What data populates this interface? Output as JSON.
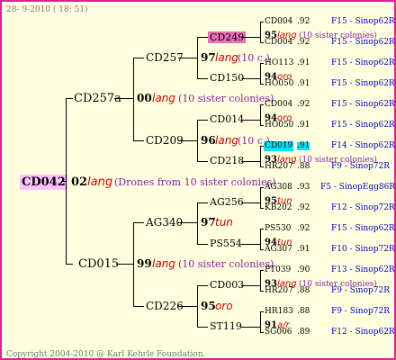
{
  "header": {
    "date": "28- 9-2010 ( 18: 51)"
  },
  "footer": {
    "copyright": "Copyright 2004-2010 @ Karl Kehrle Foundation."
  },
  "colors": {
    "border": "#e0209a",
    "background": "#ffffe0",
    "drone_red": "#d00000",
    "note_purple": "#8a1f9e",
    "source_blue": "#0000c8",
    "highlight_pink": "#ea6fb7",
    "highlight_cyan": "#00e5ff"
  },
  "root": {
    "name": "CD042",
    "year": "02",
    "breed": "lang",
    "note": "(Drones from 10 sister colonies)"
  },
  "gen1": [
    {
      "name": "CD257a",
      "year": "00",
      "breed": "lang",
      "note": "(10 sister colonies)"
    },
    {
      "name": "CD015",
      "year": "99",
      "breed": "lang",
      "note": "(10 sister colonies)"
    }
  ],
  "gen2": [
    {
      "name": "CD257",
      "year": "97",
      "breed": "lang",
      "note": "(10 c.)"
    },
    {
      "name": "CD209",
      "year": "96",
      "breed": "lang",
      "note": "(10 c.)"
    },
    {
      "name": "AG340",
      "year": "97",
      "breed": "tun",
      "note": ""
    },
    {
      "name": "CD226",
      "year": "95",
      "breed": "oro",
      "note": ""
    }
  ],
  "gen3": [
    {
      "name": "CD249",
      "year": "95",
      "breed": "lang",
      "note": "(10 sister colonies)"
    },
    {
      "name": "CD150",
      "year": "94",
      "breed": "oro",
      "note": ""
    },
    {
      "name": "CD014",
      "year": "94",
      "breed": "oro",
      "note": ""
    },
    {
      "name": "CD218",
      "year": "93",
      "breed": "lang",
      "note": "(10 sister colonies)"
    },
    {
      "name": "AG256",
      "year": "95",
      "breed": "tun",
      "note": ""
    },
    {
      "name": "PS554",
      "year": "94",
      "breed": "tun",
      "note": ""
    },
    {
      "name": "CD003",
      "year": "93",
      "breed": "lang",
      "note": "(10 sister colonies)"
    },
    {
      "name": "ST119",
      "year": "91",
      "breed": "a/r",
      "note": ""
    }
  ],
  "gen4": [
    {
      "name": "CD004",
      "year": ".92",
      "source": "F15 - Sinop62R"
    },
    {
      "name": "CD004",
      "year": ".92",
      "source": "F15 - Sinop62R"
    },
    {
      "name": "HO113",
      "year": ".91",
      "source": "F15 - Sinop62R"
    },
    {
      "name": "HO050",
      "year": ".91",
      "source": "F15 - Sinop62R"
    },
    {
      "name": "CD004",
      "year": ".92",
      "source": "F15 - Sinop62R"
    },
    {
      "name": "HO050",
      "year": ".91",
      "source": "F15 - Sinop62R"
    },
    {
      "name": "CD019",
      "year": ".91",
      "source": "F14 - Sinop62R"
    },
    {
      "name": "HR207",
      "year": ".88",
      "source": "F9 - Sinop72R"
    },
    {
      "name": "AG308",
      "year": ".93",
      "source": "F5 - SinopEgg86R"
    },
    {
      "name": "KB202",
      "year": ".92",
      "source": "F12 - Sinop72R"
    },
    {
      "name": "PS530",
      "year": ".92",
      "source": "F15 - Sinop62R"
    },
    {
      "name": "AG307",
      "year": ".91",
      "source": "F10 - Sinop72R"
    },
    {
      "name": "PT039",
      "year": ".90",
      "source": "F13 - Sinop62R"
    },
    {
      "name": "HR207",
      "year": ".88",
      "source": "F9 - Sinop72R"
    },
    {
      "name": "HR183",
      "year": ".88",
      "source": "F9 - Sinop72R"
    },
    {
      "name": "SG006",
      "year": ".89",
      "source": "F12 - Sinop62R"
    }
  ]
}
